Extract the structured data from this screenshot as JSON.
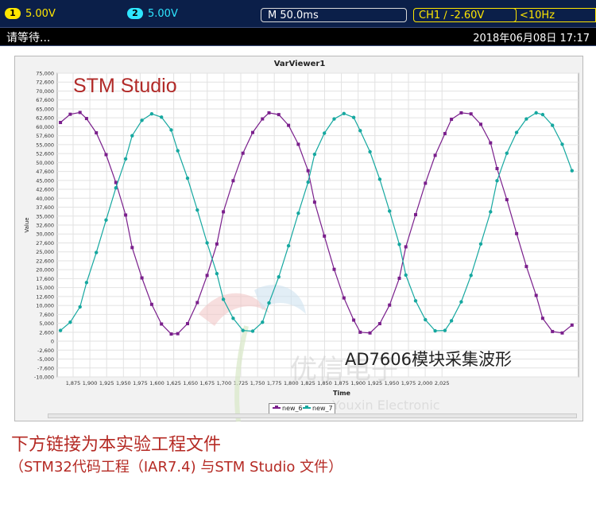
{
  "scope": {
    "ch1_num": "1",
    "ch1_volt": "5.00V",
    "ch2_num": "2",
    "ch2_volt": "5.00V",
    "timebase": "M 50.0ms",
    "trigger": "CH1 ∕ -2.60V",
    "freq": "<10Hz",
    "status": "请等待...",
    "datetime": "2018年06月08日 17:17"
  },
  "panel": {
    "title": "VarViewer1"
  },
  "overlays": {
    "stm_studio": "STM Studio",
    "ad_caption": "AD7606模块采集波形",
    "watermark": "优信电子",
    "watermark_en": "Youxin Electronic"
  },
  "legend": {
    "s1": "new_6",
    "s2": "new_7"
  },
  "captions": {
    "line1": "下方链接为本实验工程文件",
    "line2": "（STM32代码工程（IAR7.4) 与STM Studio 文件）"
  },
  "chart_data": {
    "type": "line",
    "title": "VarViewer1",
    "xlabel": "Time",
    "ylabel": "Value",
    "xlim": [
      1875,
      2035
    ],
    "ylim": [
      -10000,
      75000
    ],
    "x_ticks": [
      "1,875",
      "1,900",
      "1,925",
      "1,950",
      "1,975",
      "1,600",
      "1,625",
      "1,650",
      "1,675",
      "1,700",
      "1,725",
      "1,750",
      "1,775",
      "1,800",
      "1,825",
      "1,850",
      "1,875",
      "1,900",
      "1,925",
      "1,950",
      "1,975",
      "2,000",
      "2,025"
    ],
    "x_tick_values": [
      1875,
      1900,
      1925,
      1950,
      1975,
      1600,
      1625,
      1650,
      1675,
      1700,
      1725,
      1750,
      1775,
      1800,
      1825,
      1850,
      1875,
      1900,
      1925,
      1950,
      1975,
      2000,
      2025
    ],
    "y_ticks": [
      "75,000",
      "72,600",
      "70,000",
      "67,600",
      "65,000",
      "62,600",
      "60,000",
      "57,600",
      "55,000",
      "52,600",
      "50,000",
      "47,600",
      "45,000",
      "42,600",
      "40,000",
      "37,600",
      "35,000",
      "32,600",
      "30,000",
      "27,600",
      "25,000",
      "22,600",
      "20,000",
      "17,600",
      "15,000",
      "12,600",
      "10,000",
      "7,600",
      "5,000",
      "2,600",
      "0",
      "-2,600",
      "-5,000",
      "-7,600",
      "-10,000"
    ],
    "grid": true,
    "legend_position": "bottom-center",
    "series": [
      {
        "name": "new_6",
        "color": "#7a1f8c",
        "x": [
          1876,
          1879,
          1882,
          1884,
          1887,
          1890,
          1893,
          1896,
          1898,
          1901,
          1904,
          1907,
          1910,
          1912,
          1915,
          1918,
          1921,
          1924,
          1926,
          1929,
          1932,
          1935,
          1938,
          1940,
          1943,
          1946,
          1949,
          1952,
          1954,
          1957,
          1960,
          1963,
          1966,
          1968,
          1971,
          1974,
          1977,
          1980,
          1982,
          1985,
          1988,
          1991,
          1994,
          1996,
          1999,
          2002,
          2005,
          2008,
          2010,
          2013,
          2016,
          2019,
          2022,
          2024,
          2027,
          2030,
          2033
        ],
        "y": [
          61200,
          63500,
          64000,
          62300,
          58300,
          52200,
          44400,
          35300,
          26200,
          17700,
          10300,
          4800,
          2000,
          2100,
          4900,
          10800,
          18400,
          27200,
          36200,
          44900,
          52600,
          58400,
          62200,
          63900,
          63400,
          60400,
          55100,
          47700,
          38900,
          29400,
          20100,
          12100,
          5900,
          2500,
          2300,
          4900,
          10100,
          17600,
          26400,
          35400,
          44200,
          52000,
          58100,
          62100,
          63900,
          63600,
          60700,
          55500,
          48300,
          39600,
          30100,
          20900,
          12800,
          6400,
          2700,
          2300,
          4500
        ]
      },
      {
        "name": "new_7",
        "color": "#16a8a0",
        "x": [
          1876,
          1879,
          1882,
          1884,
          1887,
          1890,
          1893,
          1896,
          1898,
          1901,
          1904,
          1907,
          1910,
          1912,
          1915,
          1918,
          1921,
          1924,
          1926,
          1929,
          1932,
          1935,
          1938,
          1940,
          1943,
          1946,
          1949,
          1952,
          1954,
          1957,
          1960,
          1963,
          1966,
          1968,
          1971,
          1974,
          1977,
          1980,
          1982,
          1985,
          1988,
          1991,
          1994,
          1996,
          1999,
          2002,
          2005,
          2008,
          2010,
          2013,
          2016,
          2019,
          2022,
          2024,
          2027,
          2030,
          2033
        ],
        "y": [
          3000,
          5300,
          9600,
          16400,
          24800,
          33900,
          42900,
          51000,
          57500,
          61800,
          63600,
          62700,
          59100,
          53300,
          45600,
          36700,
          27500,
          18900,
          11700,
          6400,
          3000,
          2800,
          5300,
          10700,
          18000,
          26700,
          35800,
          44500,
          52300,
          58200,
          62200,
          63700,
          62600,
          58900,
          53000,
          45300,
          36400,
          27100,
          18500,
          11300,
          6000,
          2900,
          3000,
          5700,
          11000,
          18400,
          27200,
          36200,
          44900,
          52600,
          58400,
          62200,
          63900,
          63400,
          60400,
          55100,
          47700
        ]
      }
    ]
  }
}
